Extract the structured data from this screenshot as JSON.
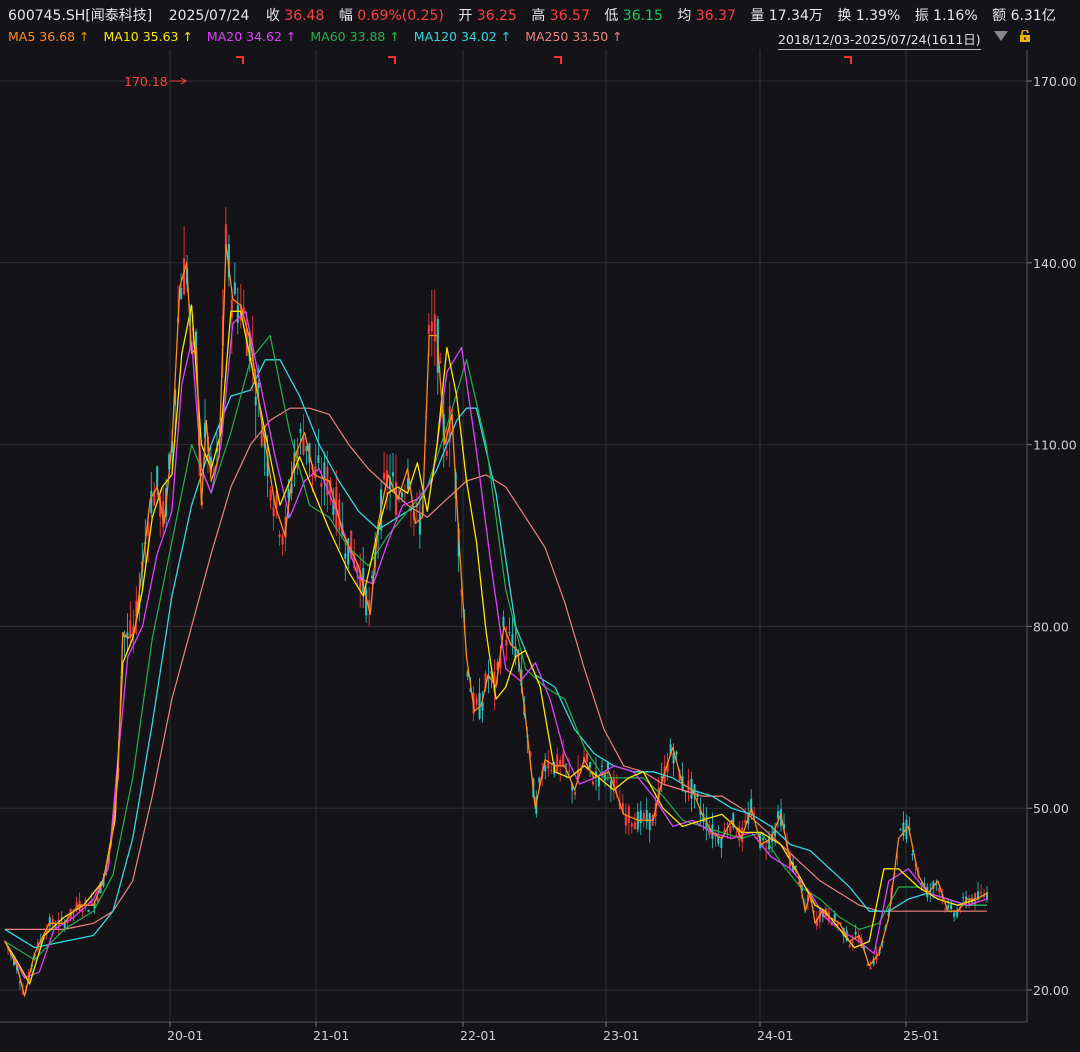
{
  "header": {
    "symbol": "600745.SH[闻泰科技]",
    "date": "2025/07/24",
    "close_label": "收",
    "close": "36.48",
    "change_label": "幅",
    "change": "0.69%(0.25)",
    "open_label": "开",
    "open": "36.25",
    "high_label": "高",
    "high": "36.57",
    "low_label": "低",
    "low": "36.15",
    "avg_label": "均",
    "avg": "36.37",
    "volume_label": "量",
    "volume": "17.34万",
    "turnover_label": "换",
    "turnover": "1.39%",
    "amplitude_label": "振",
    "amplitude": "1.16%",
    "amount_label": "额",
    "amount": "6.31亿"
  },
  "ma_legend": [
    {
      "label": "MA5 36.68 ↑",
      "color": "#ff8a1f"
    },
    {
      "label": "MA10 35.63 ↑",
      "color": "#ffe600"
    },
    {
      "label": "MA20 34.62 ↑",
      "color": "#e040fb"
    },
    {
      "label": "MA60 33.88 ↑",
      "color": "#22b04b"
    },
    {
      "label": "MA120 34.02 ↑",
      "color": "#33d6e0"
    },
    {
      "label": "MA250 33.50 ↑",
      "color": "#f08080"
    }
  ],
  "range_label": "2018/12/03-2025/07/24(1611日)",
  "icons": {
    "dropdown": "dropdown-triangle-icon",
    "lock": "lock-icon"
  },
  "colors": {
    "background": "#141418",
    "grid": "#2c2c30",
    "up": "#ff3b3b",
    "down": "#22c5c5"
  },
  "chart_data": {
    "type": "line",
    "title": "",
    "x_ticks": [
      "20-01",
      "21-01",
      "22-01",
      "23-01",
      "24-01",
      "25-01"
    ],
    "y_ticks": [
      "170.00",
      "140.00",
      "110.00",
      "80.00",
      "50.00",
      "20.00"
    ],
    "ylim": [
      20,
      170
    ],
    "max_annotation": "170.18",
    "grid": true,
    "x_tick_fractions": [
      0.0,
      0.142,
      0.284,
      0.422,
      0.561,
      0.707
    ],
    "series": [
      {
        "name": "MA5",
        "color": "#ff8a1f",
        "width": 1.3,
        "x": [
          0.0,
          0.012,
          0.02,
          0.03,
          0.045,
          0.06,
          0.075,
          0.09,
          0.1,
          0.108,
          0.115,
          0.12,
          0.125,
          0.132,
          0.14,
          0.148,
          0.155,
          0.162,
          0.17,
          0.178,
          0.185,
          0.19,
          0.195,
          0.2,
          0.205,
          0.21,
          0.218,
          0.225,
          0.232,
          0.24,
          0.25,
          0.262,
          0.275,
          0.285,
          0.295,
          0.305,
          0.315,
          0.33,
          0.345,
          0.36,
          0.372,
          0.38,
          0.39,
          0.4,
          0.41,
          0.418,
          0.425,
          0.432,
          0.44,
          0.448,
          0.455,
          0.462,
          0.47,
          0.478,
          0.485,
          0.492,
          0.5,
          0.508,
          0.515,
          0.522,
          0.53,
          0.54,
          0.55,
          0.56,
          0.57,
          0.58,
          0.59,
          0.6,
          0.615,
          0.63,
          0.645,
          0.66,
          0.67,
          0.68,
          0.69,
          0.7,
          0.71,
          0.72,
          0.73,
          0.74,
          0.75,
          0.76,
          0.77,
          0.78,
          0.79,
          0.8,
          0.808,
          0.815,
          0.82,
          0.825,
          0.832,
          0.84,
          0.85,
          0.86,
          0.87,
          0.88,
          0.89,
          0.9,
          0.91,
          0.92,
          0.93,
          0.94,
          0.95,
          0.96,
          0.97,
          0.98,
          0.99,
          1.0
        ],
        "y": [
          28,
          24,
          19,
          26,
          31,
          31,
          34,
          34,
          38,
          44,
          55,
          79,
          78,
          79,
          90,
          101,
          103,
          97,
          110,
          136,
          140,
          125,
          126,
          100,
          114,
          104,
          108,
          143,
          134,
          133,
          127,
          113,
          100,
          95,
          108,
          112,
          105,
          104,
          95,
          90,
          82,
          97,
          105,
          101,
          106,
          97,
          98,
          128,
          128,
          110,
          115,
          95,
          75,
          66,
          67,
          72,
          70,
          80,
          77,
          76,
          65,
          50,
          58,
          57,
          57,
          53,
          58,
          55,
          56,
          49,
          48,
          48,
          55,
          60,
          54,
          53,
          49,
          46,
          45,
          48,
          45,
          50,
          44,
          45,
          49,
          41,
          39,
          33,
          36,
          31,
          33,
          32,
          31,
          28,
          29,
          24,
          26,
          32,
          45,
          47,
          39,
          36,
          38,
          33,
          33,
          35,
          35,
          36
        ]
      },
      {
        "name": "MA10",
        "color": "#ffe600",
        "width": 1.3,
        "x": [
          0.0,
          0.015,
          0.025,
          0.04,
          0.06,
          0.08,
          0.1,
          0.112,
          0.12,
          0.13,
          0.14,
          0.15,
          0.16,
          0.17,
          0.18,
          0.19,
          0.2,
          0.21,
          0.22,
          0.23,
          0.24,
          0.25,
          0.265,
          0.28,
          0.29,
          0.3,
          0.315,
          0.33,
          0.35,
          0.365,
          0.38,
          0.39,
          0.4,
          0.41,
          0.42,
          0.43,
          0.44,
          0.45,
          0.46,
          0.47,
          0.48,
          0.49,
          0.5,
          0.51,
          0.52,
          0.53,
          0.545,
          0.56,
          0.575,
          0.59,
          0.605,
          0.62,
          0.635,
          0.65,
          0.67,
          0.69,
          0.71,
          0.73,
          0.75,
          0.77,
          0.79,
          0.805,
          0.815,
          0.825,
          0.835,
          0.85,
          0.865,
          0.88,
          0.895,
          0.91,
          0.93,
          0.95,
          0.97,
          0.99,
          1.0
        ],
        "y": [
          28,
          24,
          21,
          29,
          32,
          34,
          38,
          48,
          74,
          78,
          86,
          98,
          103,
          105,
          125,
          133,
          110,
          106,
          112,
          132,
          132,
          124,
          112,
          100,
          104,
          108,
          102,
          96,
          89,
          85,
          96,
          102,
          103,
          102,
          107,
          99,
          110,
          126,
          118,
          104,
          94,
          79,
          68,
          70,
          75,
          76,
          70,
          56,
          55,
          57,
          55,
          53,
          55,
          56,
          50,
          47,
          48,
          49,
          46,
          46,
          44,
          40,
          37,
          34,
          33,
          30,
          27,
          28,
          40,
          40,
          37,
          35,
          34,
          35,
          36
        ]
      },
      {
        "name": "MA20",
        "color": "#e040fb",
        "width": 1.3,
        "x": [
          0.0,
          0.02,
          0.035,
          0.05,
          0.07,
          0.09,
          0.105,
          0.115,
          0.125,
          0.14,
          0.155,
          0.17,
          0.18,
          0.19,
          0.2,
          0.21,
          0.22,
          0.232,
          0.245,
          0.26,
          0.275,
          0.29,
          0.305,
          0.32,
          0.34,
          0.36,
          0.375,
          0.39,
          0.405,
          0.42,
          0.435,
          0.45,
          0.465,
          0.48,
          0.495,
          0.51,
          0.525,
          0.54,
          0.555,
          0.57,
          0.585,
          0.6,
          0.62,
          0.64,
          0.66,
          0.68,
          0.7,
          0.72,
          0.74,
          0.76,
          0.78,
          0.8,
          0.82,
          0.835,
          0.85,
          0.87,
          0.885,
          0.9,
          0.92,
          0.94,
          0.96,
          0.98,
          1.0
        ],
        "y": [
          28,
          22,
          23,
          30,
          32,
          35,
          40,
          58,
          75,
          80,
          92,
          99,
          120,
          127,
          106,
          102,
          110,
          130,
          132,
          120,
          108,
          98,
          104,
          106,
          98,
          88,
          87,
          94,
          100,
          101,
          104,
          122,
          126,
          109,
          90,
          73,
          71,
          74,
          68,
          59,
          54,
          55,
          57,
          56,
          52,
          47,
          48,
          46,
          45,
          46,
          42,
          40,
          36,
          32,
          30,
          28,
          26,
          38,
          40,
          36,
          35,
          34,
          35
        ]
      },
      {
        "name": "MA60",
        "color": "#22b04b",
        "width": 1.2,
        "x": [
          0.0,
          0.03,
          0.06,
          0.09,
          0.11,
          0.13,
          0.15,
          0.17,
          0.19,
          0.21,
          0.23,
          0.25,
          0.27,
          0.29,
          0.31,
          0.33,
          0.35,
          0.37,
          0.39,
          0.41,
          0.43,
          0.45,
          0.47,
          0.49,
          0.51,
          0.53,
          0.55,
          0.57,
          0.59,
          0.61,
          0.63,
          0.65,
          0.67,
          0.69,
          0.71,
          0.73,
          0.75,
          0.77,
          0.79,
          0.81,
          0.83,
          0.85,
          0.87,
          0.89,
          0.91,
          0.93,
          0.95,
          0.97,
          1.0
        ],
        "y": [
          28,
          25,
          30,
          33,
          39,
          55,
          78,
          94,
          110,
          102,
          112,
          124,
          128,
          112,
          100,
          98,
          93,
          90,
          95,
          99,
          103,
          113,
          124,
          110,
          86,
          73,
          70,
          68,
          60,
          55,
          55,
          55,
          52,
          48,
          47,
          46,
          45,
          46,
          41,
          37,
          35,
          32,
          30,
          31,
          37,
          37,
          35,
          34,
          34
        ]
      },
      {
        "name": "MA120",
        "color": "#33d6e0",
        "width": 1.3,
        "x": [
          0.0,
          0.03,
          0.06,
          0.09,
          0.11,
          0.13,
          0.15,
          0.17,
          0.19,
          0.21,
          0.23,
          0.25,
          0.265,
          0.28,
          0.3,
          0.32,
          0.34,
          0.36,
          0.38,
          0.4,
          0.42,
          0.44,
          0.46,
          0.47,
          0.48,
          0.5,
          0.52,
          0.54,
          0.56,
          0.58,
          0.6,
          0.62,
          0.64,
          0.66,
          0.68,
          0.7,
          0.72,
          0.74,
          0.76,
          0.78,
          0.8,
          0.82,
          0.84,
          0.86,
          0.88,
          0.9,
          0.92,
          0.94,
          0.96,
          0.98,
          1.0
        ],
        "y": [
          30,
          27,
          28,
          29,
          33,
          45,
          64,
          85,
          100,
          110,
          118,
          119,
          124,
          124,
          118,
          110,
          104,
          99,
          96,
          98,
          100,
          106,
          114,
          116,
          116,
          102,
          80,
          72,
          70,
          63,
          59,
          57,
          56,
          56,
          55,
          53,
          52,
          50,
          49,
          47,
          44,
          43,
          40,
          37,
          33,
          33,
          35,
          36,
          35,
          34,
          34
        ]
      },
      {
        "name": "MA250",
        "color": "#f08080",
        "width": 1.2,
        "x": [
          0.0,
          0.03,
          0.06,
          0.09,
          0.11,
          0.13,
          0.15,
          0.17,
          0.19,
          0.21,
          0.23,
          0.25,
          0.27,
          0.29,
          0.31,
          0.33,
          0.35,
          0.37,
          0.39,
          0.41,
          0.43,
          0.45,
          0.47,
          0.49,
          0.51,
          0.53,
          0.55,
          0.57,
          0.59,
          0.61,
          0.63,
          0.65,
          0.67,
          0.69,
          0.71,
          0.73,
          0.75,
          0.77,
          0.79,
          0.81,
          0.83,
          0.85,
          0.87,
          0.89,
          0.91,
          0.93,
          0.95,
          0.97,
          1.0
        ],
        "y": [
          30,
          30,
          30,
          31,
          33,
          38,
          52,
          68,
          80,
          92,
          103,
          110,
          114,
          116,
          116,
          115,
          110,
          106,
          103,
          100,
          98,
          101,
          104,
          105,
          103,
          98,
          93,
          84,
          73,
          63,
          57,
          56,
          54,
          53,
          52,
          52,
          50,
          47,
          44,
          41,
          38,
          36,
          34,
          33,
          33,
          33,
          33,
          33,
          33
        ]
      }
    ]
  }
}
